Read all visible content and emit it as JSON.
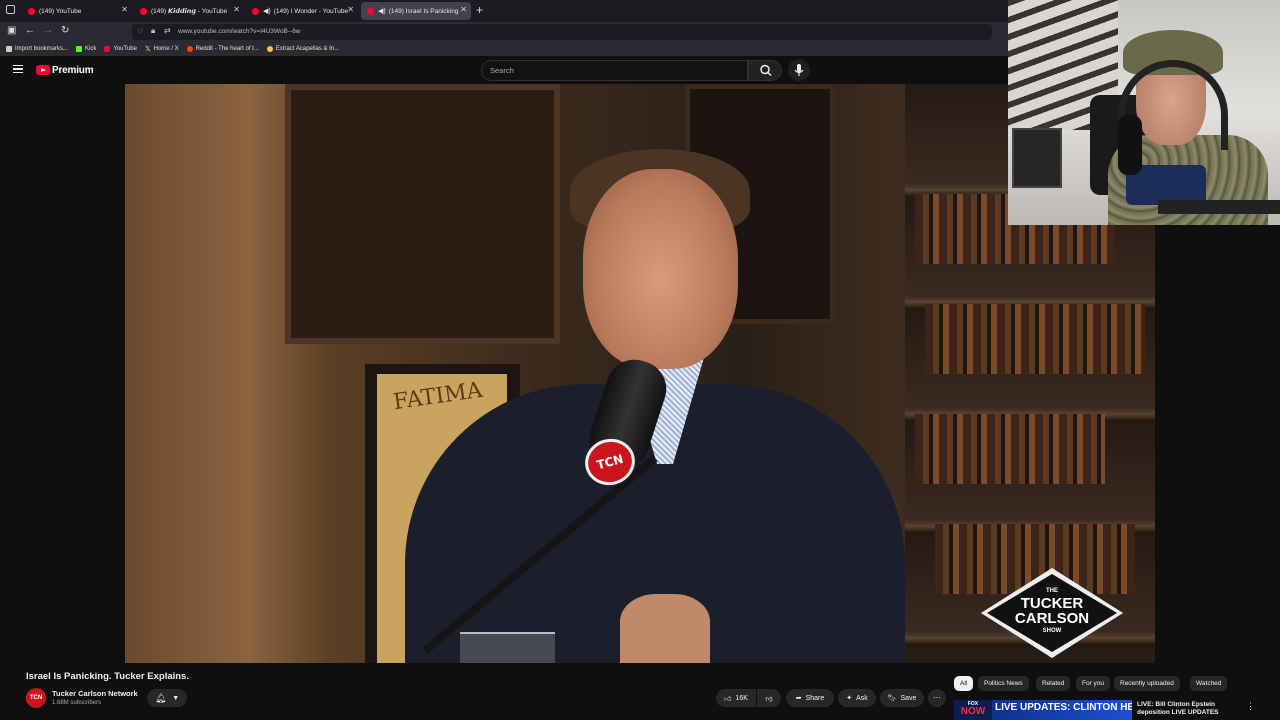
{
  "browser": {
    "tabs": [
      {
        "label": "(149) YouTube",
        "active": false,
        "audio": false
      },
      {
        "label": "(149) 𝙆𝙞𝙙𝙙𝙞𝙣𝙜 - YouTube",
        "active": false,
        "audio": false
      },
      {
        "label": "(149) I Wonder - YouTube",
        "active": false,
        "audio": true
      },
      {
        "label": "(149) Israel Is Panicking. Tu",
        "active": true,
        "audio": true
      }
    ],
    "url": "www.youtube.com/watch?v=I4U3WoB--6w",
    "bookmarks": [
      {
        "label": "Import bookmarks...",
        "color": "#cccccc"
      },
      {
        "label": "Kick",
        "color": "#53fc18"
      },
      {
        "label": "YouTube",
        "color": "#ff0033"
      },
      {
        "label": "Home / X",
        "color": "#ffffff"
      },
      {
        "label": "Reddit - The heart of t...",
        "color": "#ff4500"
      },
      {
        "label": "Extract Acapellas & In...",
        "color": "#f5c542"
      }
    ]
  },
  "youtube": {
    "brand": "Premium",
    "search_placeholder": "Search",
    "accent": "#ff0033"
  },
  "video": {
    "title": "Israel Is Panicking. Tucker Explains.",
    "poster_text": "FATIMA",
    "mic_badge": "TCN",
    "show_logo": {
      "the": "THE",
      "line1": "TUCKER",
      "line2": "CARLSON",
      "line3": "SHOW"
    }
  },
  "channel": {
    "name": "Tucker Carlson Network",
    "subscribers": "1.68M subscribers",
    "avatar_text": "TCN"
  },
  "actions": {
    "likes": "16K",
    "share": "Share",
    "ask": "Ask",
    "save": "Save",
    "more": "⋯"
  },
  "chips": [
    "All",
    "Politics News",
    "Related",
    "For you",
    "Recently uploaded",
    "Watched"
  ],
  "recommendation": {
    "thumb_badge_line1": "FOX",
    "thumb_badge_line2": "NOW",
    "thumb_text": "LIVE UPDATES: CLINTON HEARINGS",
    "title": "LIVE: Bill Clinton Epstein deposition LIVE UPDATES"
  }
}
